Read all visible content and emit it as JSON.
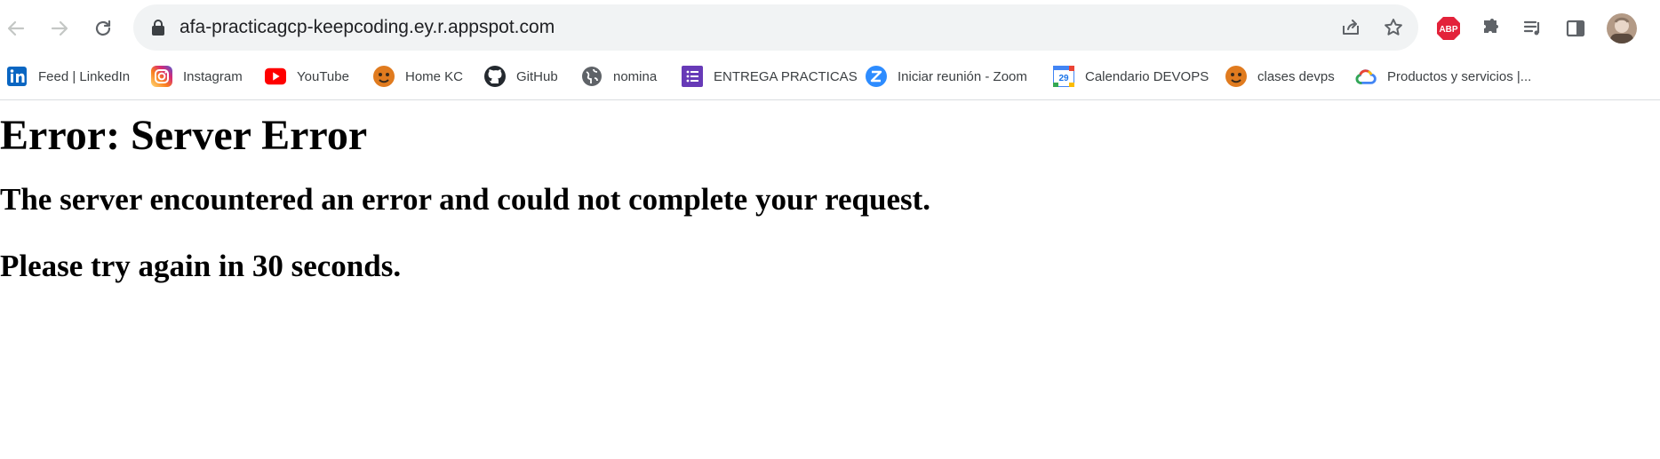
{
  "browser": {
    "url": "afa-practicagcp-keepcoding.ey.r.appspot.com",
    "extensions": {
      "abp_label": "ABP"
    }
  },
  "bookmarks": [
    {
      "label": "Feed | LinkedIn",
      "icon": "linkedin-icon"
    },
    {
      "label": "Instagram",
      "icon": "instagram-icon"
    },
    {
      "label": "YouTube",
      "icon": "youtube-icon"
    },
    {
      "label": "Home KC",
      "icon": "keepcoding-icon"
    },
    {
      "label": "GitHub",
      "icon": "github-icon"
    },
    {
      "label": "nomina",
      "icon": "globe-icon"
    },
    {
      "label": "ENTREGA PRACTICAS",
      "icon": "forms-icon"
    },
    {
      "label": "Iniciar reunión - Zoom",
      "icon": "zoom-icon"
    },
    {
      "label": "Calendario DEVOPS",
      "icon": "calendar-icon"
    },
    {
      "label": "clases devps",
      "icon": "keepcoding-icon"
    },
    {
      "label": "Productos y servicios |...",
      "icon": "google-cloud-icon"
    }
  ],
  "calendar_day": "29",
  "page": {
    "title": "Error: Server Error",
    "message": "The server encountered an error and could not complete your request.",
    "retry": "Please try again in 30 seconds."
  },
  "colors": {
    "omnibox_bg": "#f1f3f4",
    "abp_red": "#e3223a",
    "linkedin_blue": "#0a66c2",
    "youtube_red": "#ff0000",
    "forms_purple": "#673ab7",
    "zoom_blue": "#2d8cff"
  }
}
